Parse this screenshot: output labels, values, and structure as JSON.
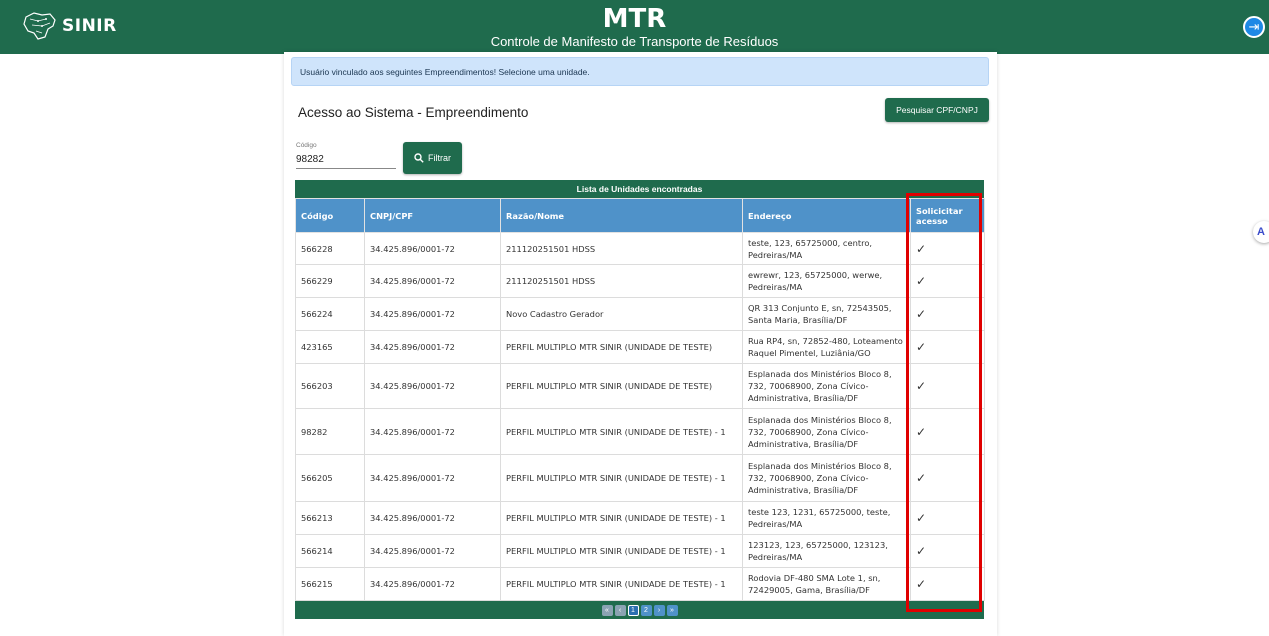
{
  "header": {
    "logo_text": "SINIR",
    "title": "MTR",
    "subtitle": "Controle de Manifesto de Transporte de Resíduos",
    "logout_icon": "logout-icon",
    "brand_color": "#1f6b4d"
  },
  "alert": {
    "text": "Usuário vinculado aos seguintes Empreendimentos! Selecione uma unidade."
  },
  "page": {
    "section_title": "Acesso ao Sistema - Empreendimento",
    "search_doc_label": "Pesquisar CPF/CNPJ",
    "code_label": "Código",
    "code_value": "98282",
    "filter_label": "Filtrar"
  },
  "table": {
    "caption": "Lista de Unidades encontradas",
    "columns": [
      "Código",
      "CNPJ/CPF",
      "Razão/Nome",
      "Endereço",
      "Solicicitar acesso"
    ],
    "rows": [
      [
        "566228",
        "34.425.896/0001-72",
        "211120251501 HDSS",
        "teste, 123, 65725000, centro, Pedreiras/MA",
        "✓"
      ],
      [
        "566229",
        "34.425.896/0001-72",
        "211120251501 HDSS",
        "ewrewr, 123, 65725000, werwe, Pedreiras/MA",
        "✓"
      ],
      [
        "566224",
        "34.425.896/0001-72",
        "Novo Cadastro Gerador",
        "QR 313 Conjunto E, sn, 72543505, Santa Maria, Brasília/DF",
        "✓"
      ],
      [
        "423165",
        "34.425.896/0001-72",
        "PERFIL MULTIPLO MTR SINIR (UNIDADE DE TESTE)",
        "Rua RP4, sn, 72852-480, Loteamento Raquel Pimentel, Luziânia/GO",
        "✓"
      ],
      [
        "566203",
        "34.425.896/0001-72",
        "PERFIL MULTIPLO MTR SINIR (UNIDADE DE TESTE)",
        "Esplanada dos Ministérios Bloco 8, 732, 70068900, Zona Cívico-Administrativa, Brasília/DF",
        "✓"
      ],
      [
        "98282",
        "34.425.896/0001-72",
        "PERFIL MULTIPLO MTR SINIR (UNIDADE DE TESTE) - 1",
        "Esplanada dos Ministérios Bloco 8, 732, 70068900, Zona Cívico-Administrativa, Brasília/DF",
        "✓"
      ],
      [
        "566205",
        "34.425.896/0001-72",
        "PERFIL MULTIPLO MTR SINIR (UNIDADE DE TESTE) - 1",
        "Esplanada dos Ministérios Bloco 8, 732, 70068900, Zona Cívico-Administrativa, Brasília/DF",
        "✓"
      ],
      [
        "566213",
        "34.425.896/0001-72",
        "PERFIL MULTIPLO MTR SINIR (UNIDADE DE TESTE) - 1",
        "teste 123, 1231, 65725000, teste, Pedreiras/MA",
        "✓"
      ],
      [
        "566214",
        "34.425.896/0001-72",
        "PERFIL MULTIPLO MTR SINIR (UNIDADE DE TESTE) - 1",
        "123123, 123, 65725000, 123123, Pedreiras/MA",
        "✓"
      ],
      [
        "566215",
        "34.425.896/0001-72",
        "PERFIL MULTIPLO MTR SINIR (UNIDADE DE TESTE) - 1",
        "Rodovia DF-480 SMA Lote 1, sn, 72429005, Gama, Brasília/DF",
        "✓"
      ]
    ]
  },
  "pagination": {
    "pages": [
      "1",
      "2"
    ],
    "current": "1",
    "first_icon": "first-page-icon",
    "prev_icon": "prev-page-icon",
    "next_icon": "next-page-icon",
    "last_icon": "last-page-icon"
  },
  "highlight_color": "#e00000"
}
